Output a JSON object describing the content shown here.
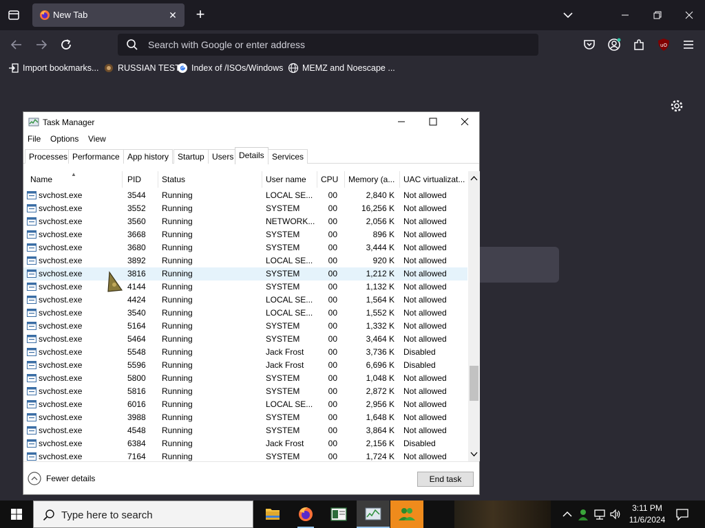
{
  "browser": {
    "tab_title": "New Tab",
    "url_placeholder": "Search with Google or enter address",
    "bookmarks": [
      {
        "label": "Import bookmarks..."
      },
      {
        "label": "RUSSIAN TEST"
      },
      {
        "label": "Index of /ISOs/Windows"
      },
      {
        "label": "MEMZ and Noescape ..."
      }
    ]
  },
  "task_manager": {
    "title": "Task Manager",
    "menu": [
      "File",
      "Options",
      "View"
    ],
    "tabs": [
      "Processes",
      "Performance",
      "App history",
      "Startup",
      "Users",
      "Details",
      "Services"
    ],
    "active_tab": "Details",
    "columns": [
      "Name",
      "PID",
      "Status",
      "User name",
      "CPU",
      "Memory (a...",
      "UAC virtualizat..."
    ],
    "rows": [
      {
        "name": "svchost.exe",
        "pid": "3544",
        "status": "Running",
        "user": "LOCAL SE...",
        "cpu": "00",
        "mem": "2,840 K",
        "uac": "Not allowed"
      },
      {
        "name": "svchost.exe",
        "pid": "3552",
        "status": "Running",
        "user": "SYSTEM",
        "cpu": "00",
        "mem": "16,256 K",
        "uac": "Not allowed"
      },
      {
        "name": "svchost.exe",
        "pid": "3560",
        "status": "Running",
        "user": "NETWORK...",
        "cpu": "00",
        "mem": "2,056 K",
        "uac": "Not allowed"
      },
      {
        "name": "svchost.exe",
        "pid": "3668",
        "status": "Running",
        "user": "SYSTEM",
        "cpu": "00",
        "mem": "896 K",
        "uac": "Not allowed"
      },
      {
        "name": "svchost.exe",
        "pid": "3680",
        "status": "Running",
        "user": "SYSTEM",
        "cpu": "00",
        "mem": "3,444 K",
        "uac": "Not allowed"
      },
      {
        "name": "svchost.exe",
        "pid": "3892",
        "status": "Running",
        "user": "LOCAL SE...",
        "cpu": "00",
        "mem": "920 K",
        "uac": "Not allowed"
      },
      {
        "name": "svchost.exe",
        "pid": "3816",
        "status": "Running",
        "user": "SYSTEM",
        "cpu": "00",
        "mem": "1,212 K",
        "uac": "Not allowed"
      },
      {
        "name": "svchost.exe",
        "pid": "4144",
        "status": "Running",
        "user": "SYSTEM",
        "cpu": "00",
        "mem": "1,132 K",
        "uac": "Not allowed"
      },
      {
        "name": "svchost.exe",
        "pid": "4424",
        "status": "Running",
        "user": "LOCAL SE...",
        "cpu": "00",
        "mem": "1,564 K",
        "uac": "Not allowed"
      },
      {
        "name": "svchost.exe",
        "pid": "3540",
        "status": "Running",
        "user": "LOCAL SE...",
        "cpu": "00",
        "mem": "1,552 K",
        "uac": "Not allowed"
      },
      {
        "name": "svchost.exe",
        "pid": "5164",
        "status": "Running",
        "user": "SYSTEM",
        "cpu": "00",
        "mem": "1,332 K",
        "uac": "Not allowed"
      },
      {
        "name": "svchost.exe",
        "pid": "5464",
        "status": "Running",
        "user": "SYSTEM",
        "cpu": "00",
        "mem": "3,464 K",
        "uac": "Not allowed"
      },
      {
        "name": "svchost.exe",
        "pid": "5548",
        "status": "Running",
        "user": "Jack Frost",
        "cpu": "00",
        "mem": "3,736 K",
        "uac": "Disabled"
      },
      {
        "name": "svchost.exe",
        "pid": "5596",
        "status": "Running",
        "user": "Jack Frost",
        "cpu": "00",
        "mem": "6,696 K",
        "uac": "Disabled"
      },
      {
        "name": "svchost.exe",
        "pid": "5800",
        "status": "Running",
        "user": "SYSTEM",
        "cpu": "00",
        "mem": "1,048 K",
        "uac": "Not allowed"
      },
      {
        "name": "svchost.exe",
        "pid": "5816",
        "status": "Running",
        "user": "SYSTEM",
        "cpu": "00",
        "mem": "2,872 K",
        "uac": "Not allowed"
      },
      {
        "name": "svchost.exe",
        "pid": "6016",
        "status": "Running",
        "user": "LOCAL SE...",
        "cpu": "00",
        "mem": "2,956 K",
        "uac": "Not allowed"
      },
      {
        "name": "svchost.exe",
        "pid": "3988",
        "status": "Running",
        "user": "SYSTEM",
        "cpu": "00",
        "mem": "1,648 K",
        "uac": "Not allowed"
      },
      {
        "name": "svchost.exe",
        "pid": "4548",
        "status": "Running",
        "user": "SYSTEM",
        "cpu": "00",
        "mem": "3,864 K",
        "uac": "Not allowed"
      },
      {
        "name": "svchost.exe",
        "pid": "6384",
        "status": "Running",
        "user": "Jack Frost",
        "cpu": "00",
        "mem": "2,156 K",
        "uac": "Disabled"
      },
      {
        "name": "svchost.exe",
        "pid": "7164",
        "status": "Running",
        "user": "SYSTEM",
        "cpu": "00",
        "mem": "1,724 K",
        "uac": "Not allowed"
      }
    ],
    "selected_pid": "3816",
    "fewer_details": "Fewer details",
    "end_task": "End task"
  },
  "taskbar": {
    "search_placeholder": "Type here to search",
    "time": "3:11 PM",
    "date": "11/6/2024"
  },
  "colors": {
    "firefox_dark": "#1c1b22",
    "toolbar": "#2b2a33",
    "selection": "#e5f3fb",
    "taskbar_open_app": "#ef8b1c"
  }
}
